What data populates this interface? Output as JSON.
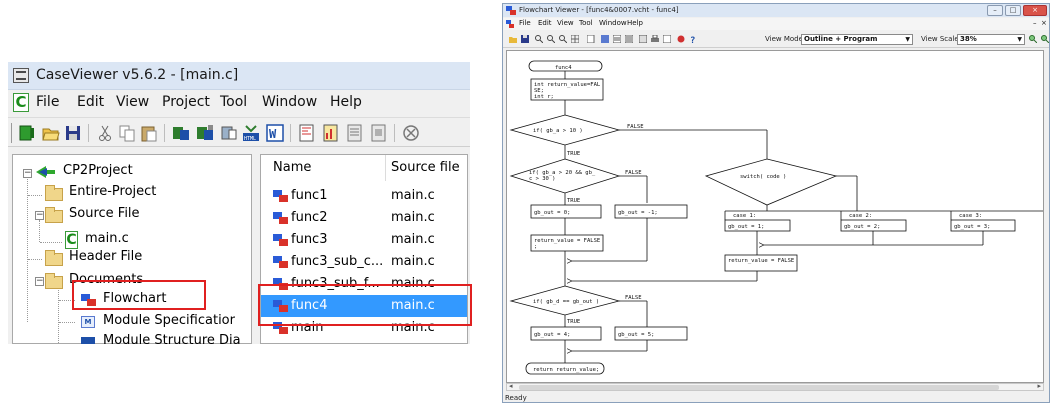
{
  "caseviewer": {
    "title": "CaseViewer v5.6.2 - [main.c]",
    "menu": [
      "File",
      "Edit",
      "View",
      "Project",
      "Tool",
      "Window",
      "Help"
    ],
    "tree": {
      "root": "CP2Project",
      "items": [
        "Entire-Project",
        "Source File",
        "main.c",
        "Header File",
        "Documents",
        "Flowchart",
        "Module Specificatior",
        "Module Structure Dia"
      ]
    },
    "list": {
      "col_name": "Name",
      "col_source": "Source file",
      "rows": [
        {
          "name": "func1",
          "source": "main.c"
        },
        {
          "name": "func2",
          "source": "main.c"
        },
        {
          "name": "func3",
          "source": "main.c"
        },
        {
          "name": "func3_sub_c...",
          "source": "main.c"
        },
        {
          "name": "func3_sub_f...",
          "source": "main.c"
        },
        {
          "name": "func4",
          "source": "main.c"
        },
        {
          "name": "main",
          "source": "main.c"
        }
      ],
      "selected_index": 5
    }
  },
  "flowchart_viewer": {
    "title": "Flowchart Viewer - [func4&0007.vcht - func4]",
    "menu": [
      "File",
      "Edit",
      "View",
      "Tool",
      "Window",
      "Help"
    ],
    "view_mode_label": "View Mode",
    "view_mode_value": "Outline + Program",
    "view_scale_label": "View Scale",
    "view_scale_value": "38%",
    "status": "Ready",
    "flow": {
      "start": "func4",
      "decl": [
        "int return_value=FAL",
        "SE;",
        "int r;"
      ],
      "cond1": "if( gb_a > 10 )",
      "cond2": [
        "if( gb_a > 20 && gb_",
        "c > 30 )"
      ],
      "switch": "switch( code )",
      "true_lbl": "TRUE",
      "false_lbl": "FALSE",
      "out0": "gb_out = 0;",
      "out_neg1": "gb_out = -1;",
      "ret_false": "return_value = FALSE",
      "ret_false_semi": ";",
      "case1": "case  1:",
      "case2": "case  2:",
      "case3": "case  3:",
      "case_out1": "gb_out = 1;",
      "case_out2": "gb_out = 2;",
      "case_out3": "gb_out = 3;",
      "ret_false2": "return_value = FALSE",
      "cond3": "if( gb_d == gb_out )",
      "out4": "gb_out = 4;",
      "out5": "gb_out = 5;",
      "end": "return return_value;"
    }
  }
}
